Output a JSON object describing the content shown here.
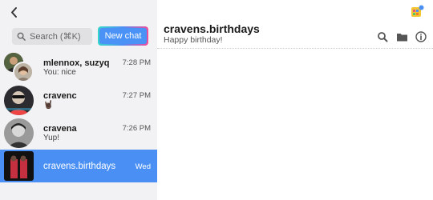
{
  "search": {
    "label": "Search (⌘K)"
  },
  "new_chat_label": "New chat",
  "chats": [
    {
      "name": "mlennox, suzyq",
      "preview": "You: nice",
      "time": "7:28 PM"
    },
    {
      "name": "cravenc",
      "preview": "🤘🏿",
      "time": "7:27 PM"
    },
    {
      "name": "cravena",
      "preview": "Yup!",
      "time": "7:26 PM"
    },
    {
      "name": "cravens.birthdays",
      "preview": "",
      "time": "Wed"
    }
  ],
  "header": {
    "title": "cravens.birthdays",
    "subtitle": "Happy birthday!"
  },
  "colors": {
    "accent": "#4a90f4",
    "sidebar": "#f2f2f4"
  },
  "icons": [
    "back-arrow-icon",
    "app-icon",
    "search-icon",
    "folder-icon",
    "info-icon"
  ]
}
